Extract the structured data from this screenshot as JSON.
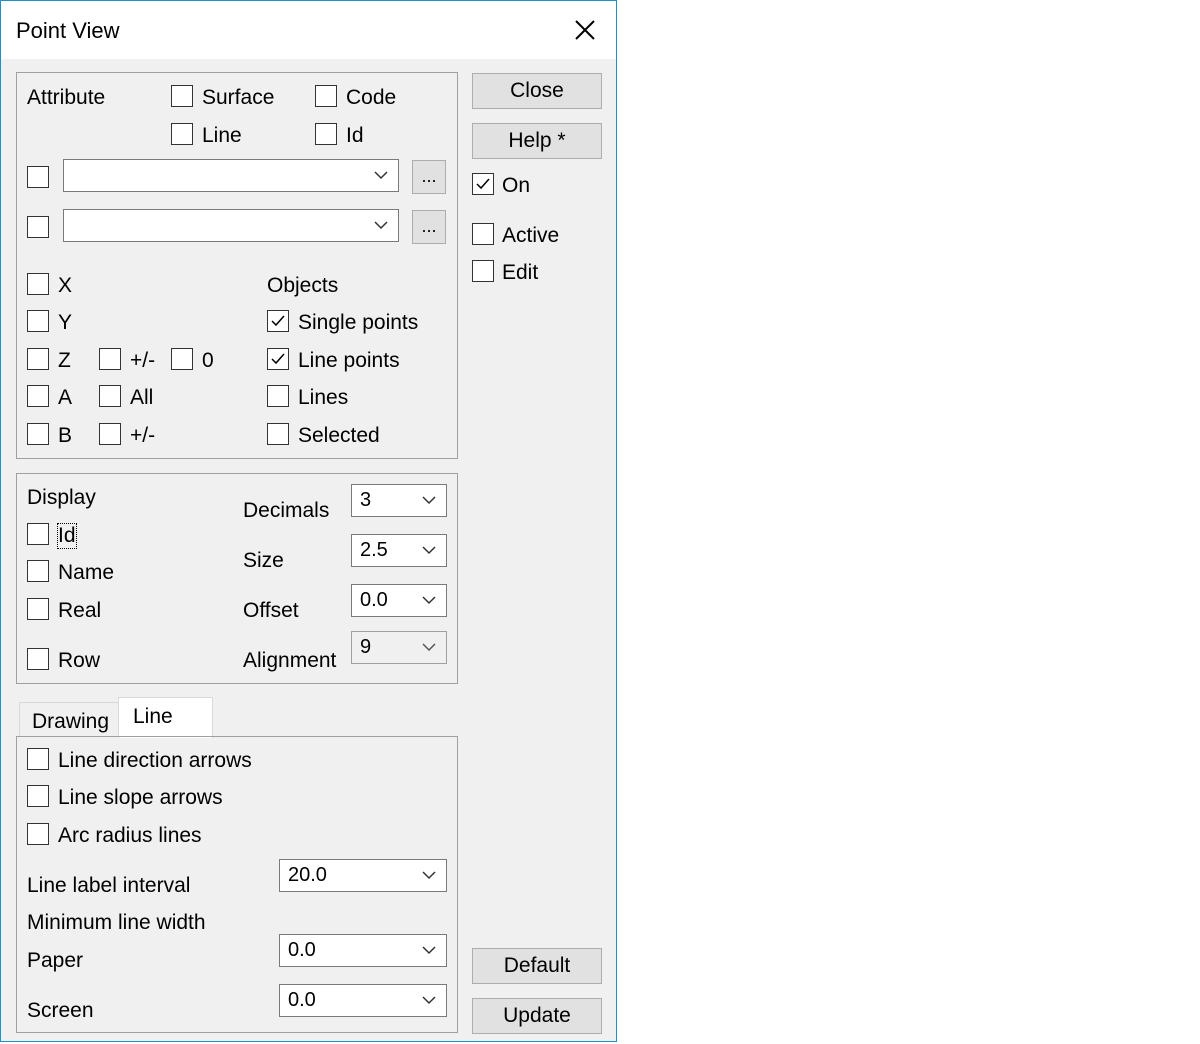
{
  "window": {
    "title": "Point View"
  },
  "attribute": {
    "label": "Attribute",
    "surface": "Surface",
    "code": "Code",
    "line": "Line",
    "id": "Id",
    "combo1": "",
    "combo2": "",
    "browse_label": "..."
  },
  "coords": {
    "x": "X",
    "y": "Y",
    "z": "Z",
    "a": "A",
    "b": "B",
    "plusminus1": "+/-",
    "zero": "0",
    "all": "All",
    "plusminus2": "+/-"
  },
  "objects": {
    "label": "Objects",
    "single_points": "Single points",
    "line_points": "Line points",
    "lines": "Lines",
    "selected": "Selected",
    "single_points_checked": true,
    "line_points_checked": true
  },
  "display": {
    "label": "Display",
    "id": "Id",
    "name": "Name",
    "real": "Real",
    "row": "Row",
    "decimals_label": "Decimals",
    "decimals_value": "3",
    "size_label": "Size",
    "size_value": "2.5",
    "offset_label": "Offset",
    "offset_value": "0.0",
    "alignment_label": "Alignment",
    "alignment_value": "9"
  },
  "tabs": {
    "drawing": "Drawing",
    "line": "Line",
    "active": "Line"
  },
  "line_tab": {
    "direction_arrows": "Line direction arrows",
    "slope_arrows": "Line slope arrows",
    "arc_radius": "Arc radius lines",
    "label_interval": "Line label interval",
    "label_interval_value": "20.0",
    "min_width": "Minimum line width",
    "paper": "Paper",
    "paper_value": "0.0",
    "screen": "Screen",
    "screen_value": "0.0"
  },
  "side": {
    "close": "Close",
    "help": "Help *",
    "on": "On",
    "on_checked": true,
    "active": "Active",
    "edit": "Edit",
    "default": "Default",
    "update": "Update"
  },
  "icons": {
    "close": "close-icon",
    "check": "checkmark-icon",
    "dropdown": "chevron-down-icon"
  },
  "colors": {
    "window_border": "#1e90c8",
    "dialog_bg": "#f0f0f0",
    "button_bg": "#e1e1e1"
  }
}
